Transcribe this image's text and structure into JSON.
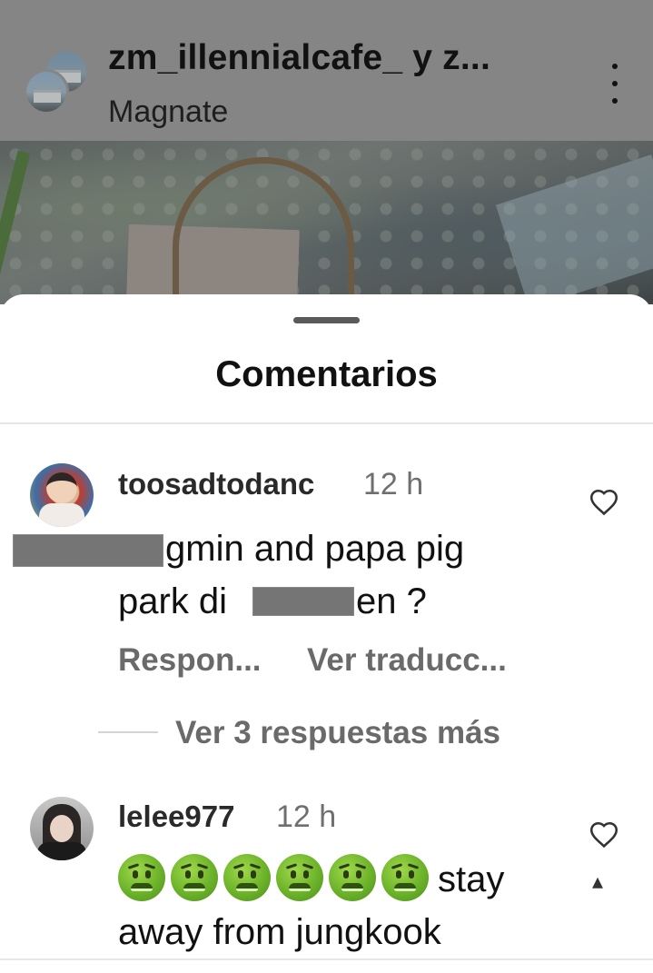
{
  "post_header": {
    "username": "zm_illennialcafe_ y z...",
    "subtitle": "Magnate",
    "more_icon": "more-vertical-icon"
  },
  "sheet": {
    "title": "Comentarios"
  },
  "comments": [
    {
      "username": "toosadtodanc",
      "time": "12 h",
      "line1_visible": "gmin and papa pig",
      "line2_start": "park di",
      "line2_end": "en ?",
      "reply_label": "Respon...",
      "translate_label": "Ver traducc...",
      "replies_label": "Ver 3 respuestas más",
      "like_icon": "heart-outline-icon"
    },
    {
      "username": "lelee977",
      "time": "12 h",
      "emoji_count": 6,
      "emoji_icon": "nauseated-face-emoji",
      "line1_text": "stay",
      "line2_text": "away from jungkook",
      "like_icon": "heart-outline-icon"
    }
  ],
  "colors": {
    "dim_overlay": "#858585",
    "sheet_bg": "#ffffff",
    "secondary_text": "#6a6a6a",
    "redaction": "#757575"
  }
}
